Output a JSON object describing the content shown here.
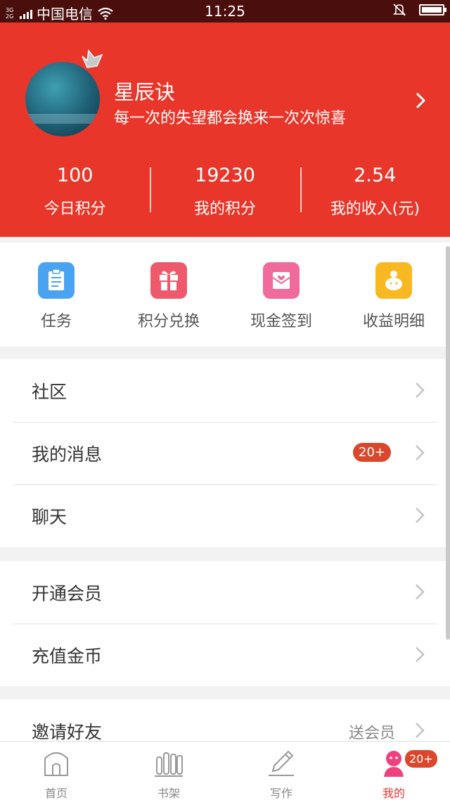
{
  "status_bar": {
    "network_type": "3G 2G",
    "carrier": "中国电信",
    "time": "11:25",
    "icons": [
      "signal-icon",
      "wifi-icon",
      "mute-bell-icon",
      "battery-icon"
    ]
  },
  "profile": {
    "name": "星辰诀",
    "motto": "每一次的失望都会换来一次次惊喜",
    "stats": [
      {
        "value": "100",
        "label": "今日积分"
      },
      {
        "value": "19230",
        "label": "我的积分"
      },
      {
        "value": "2.54",
        "label": "我的收入(元)"
      }
    ]
  },
  "quick_actions": [
    {
      "label": "任务",
      "icon": "task-clipboard-icon",
      "color": "#4aa3f0"
    },
    {
      "label": "积分兑换",
      "icon": "gift-icon",
      "color": "#ee5a6b"
    },
    {
      "label": "现金签到",
      "icon": "checkin-envelope-icon",
      "color": "#f06a9c"
    },
    {
      "label": "收益明细",
      "icon": "piggy-bank-icon",
      "color": "#f7b822"
    }
  ],
  "menu_groups": [
    [
      {
        "label": "社区"
      },
      {
        "label": "我的消息",
        "badge": "20+"
      },
      {
        "label": "聊天"
      }
    ],
    [
      {
        "label": "开通会员"
      },
      {
        "label": "充值金币"
      }
    ],
    [
      {
        "label": "邀请好友",
        "aside": "送会员"
      }
    ]
  ],
  "tabbar": {
    "tabs": [
      {
        "label": "首页",
        "icon": "home-icon"
      },
      {
        "label": "书架",
        "icon": "bookshelf-icon"
      },
      {
        "label": "写作",
        "icon": "pencil-icon"
      },
      {
        "label": "我的",
        "icon": "profile-icon",
        "badge": "20+",
        "active": true
      }
    ]
  },
  "colors": {
    "brand_red": "#e8362b",
    "badge_red": "#d9472c",
    "status_bar": "#4a0f0c"
  }
}
